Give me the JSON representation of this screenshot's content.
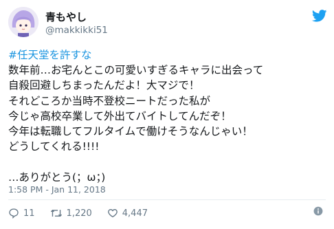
{
  "user": {
    "display_name": "青もやし",
    "handle": "@makkikki51"
  },
  "tweet": {
    "hashtag": "#任天堂を許すな",
    "lines": [
      "数年前…お宅んとこの可愛いすぎるキャラに出会って",
      "自殺回避しちまったんだよ！大マジで！",
      "それどころか当時不登校ニートだった私が",
      "今じゃ高校卒業して外出てバイトしてんだぞ！",
      "今年は転職してフルタイムで働けそうなんじゃい！",
      "どうしてくれる!!!!",
      "",
      "…ありがとう(；ω；)"
    ],
    "timestamp": "1:58 PM - Jan 11, 2018"
  },
  "actions": {
    "replies": "11",
    "retweets": "1,220",
    "likes": "4,447"
  },
  "icons": {
    "logo": "twitter-bird-icon",
    "reply": "reply-icon",
    "retweet": "retweet-icon",
    "like": "heart-icon",
    "info": "info-icon"
  },
  "colors": {
    "accent": "#1da1f2",
    "hashtag": "#1b95e0",
    "secondary_text": "#657786"
  }
}
